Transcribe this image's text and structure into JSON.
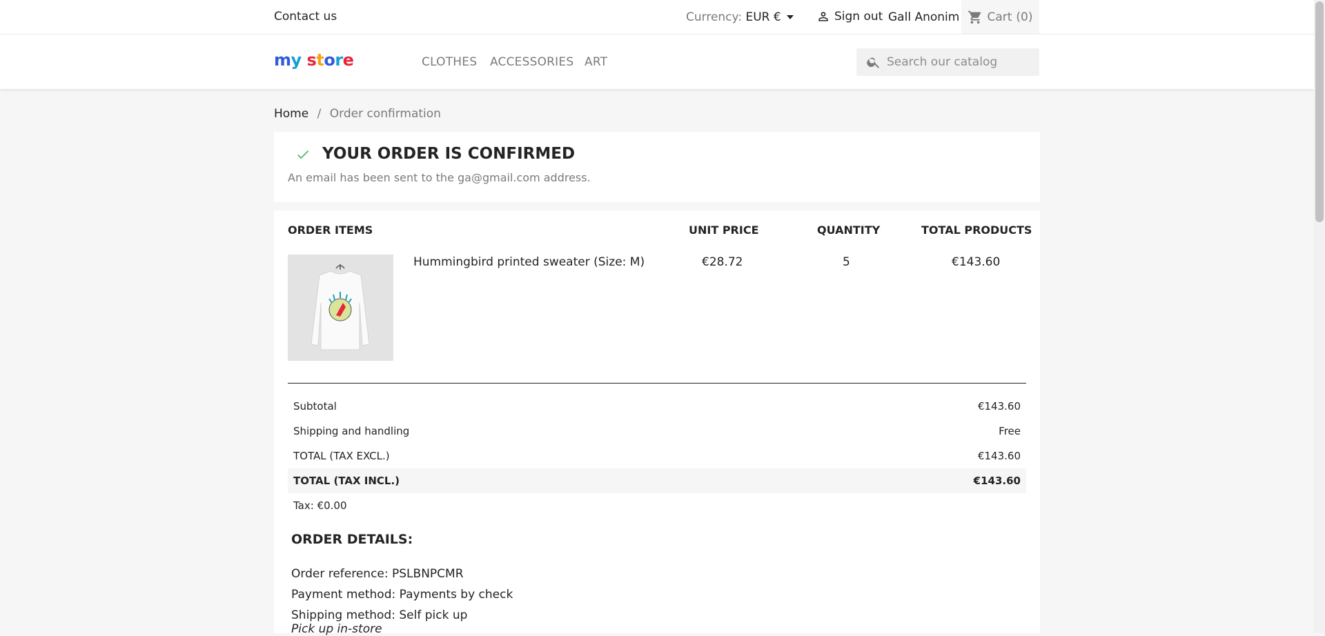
{
  "topbar": {
    "contact": "Contact us",
    "currency_label": "Currency:",
    "currency_value": "EUR €",
    "signout": "Sign out",
    "username": "Gall Anonim",
    "cart": "Cart",
    "cart_count": "(0)"
  },
  "logo": {
    "text": "my store"
  },
  "nav": {
    "items": [
      "CLOTHES",
      "ACCESSORIES",
      "ART"
    ]
  },
  "search": {
    "placeholder": "Search our catalog"
  },
  "breadcrumb": {
    "home": "Home",
    "separator": "/",
    "current": "Order confirmation"
  },
  "confirmation": {
    "title": "YOUR ORDER IS CONFIRMED",
    "message": "An email has been sent to the ga@gmail.com address."
  },
  "order_items": {
    "headers": {
      "items": "ORDER ITEMS",
      "unit_price": "UNIT PRICE",
      "quantity": "QUANTITY",
      "total": "TOTAL PRODUCTS"
    },
    "product": {
      "name": "Hummingbird printed sweater (Size: M)",
      "unit_price": "€28.72",
      "quantity": "5",
      "total": "€143.60"
    }
  },
  "totals": [
    {
      "label": "Subtotal",
      "value": "€143.60"
    },
    {
      "label": "Shipping and handling",
      "value": "Free"
    },
    {
      "label": "TOTAL (TAX EXCL.)",
      "value": "€143.60"
    },
    {
      "label": "TOTAL (TAX INCL.)",
      "value": "€143.60"
    },
    {
      "label": "Tax: €0.00",
      "value": ""
    }
  ],
  "details": {
    "title": "ORDER DETAILS:",
    "reference": "Order reference: PSLBNPCMR",
    "payment": "Payment method: Payments by check",
    "shipping": "Shipping method: Self pick up",
    "shipping_note": "Pick up in-store"
  },
  "colors": {
    "check": "#4cbb6c",
    "accent": "#24b9d7"
  }
}
